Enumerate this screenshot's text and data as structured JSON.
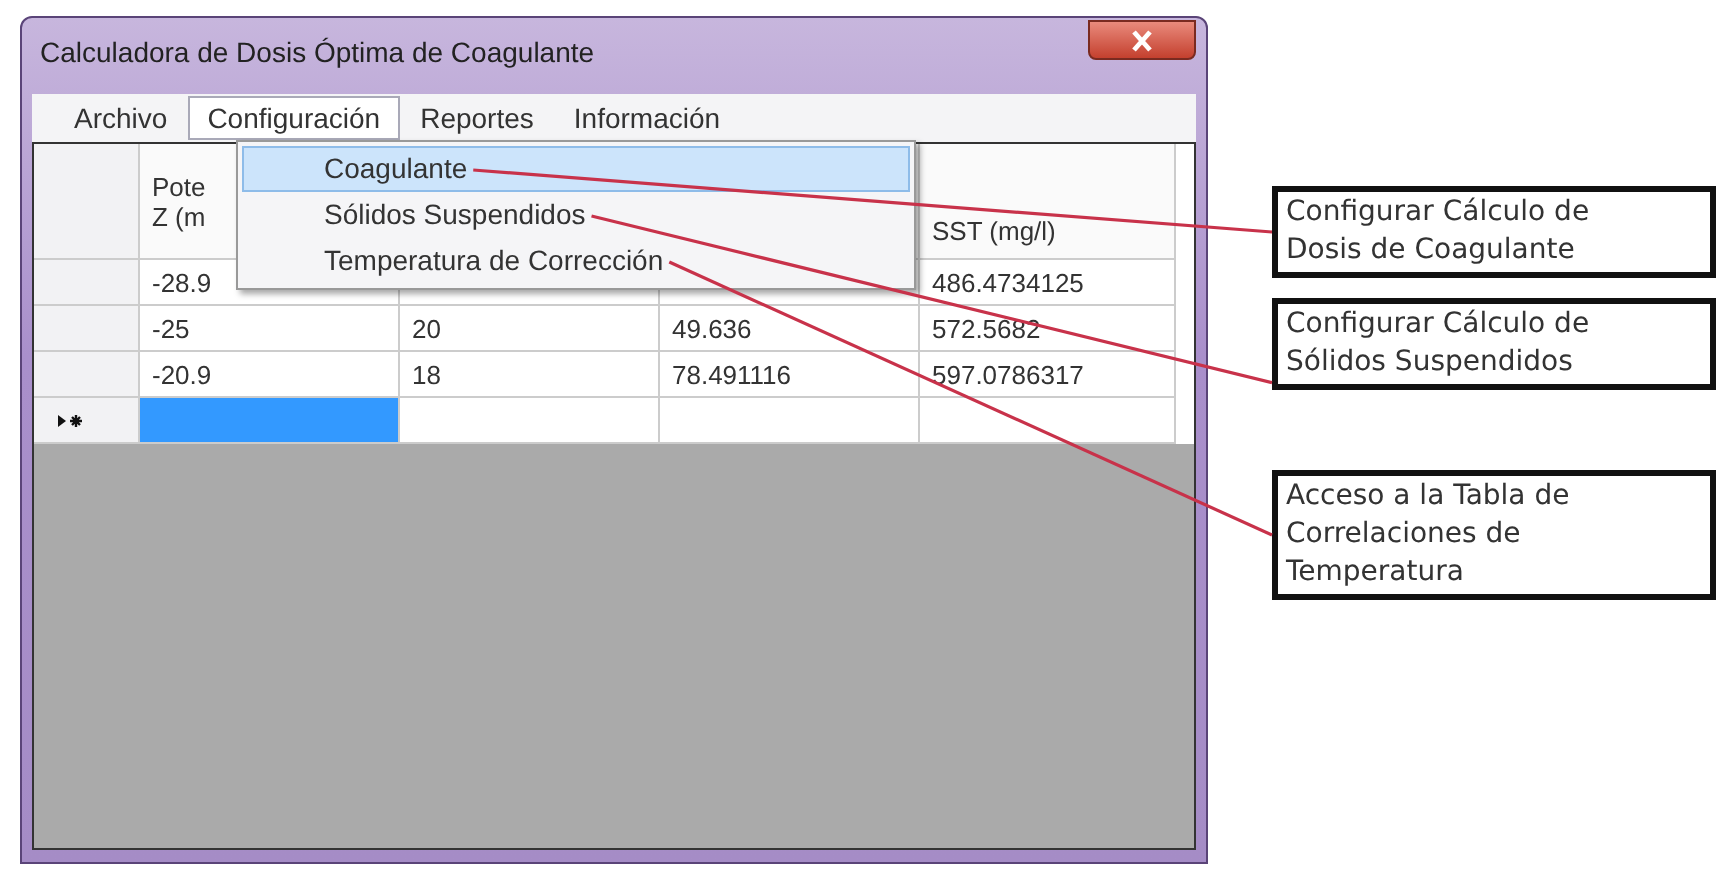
{
  "window": {
    "title": "Calculadora de Dosis Óptima de Coagulante"
  },
  "menu_bar": [
    {
      "label": "Archivo",
      "selected": false
    },
    {
      "label": "Configuración",
      "selected": true
    },
    {
      "label": "Reportes",
      "selected": false
    },
    {
      "label": "Información",
      "selected": false
    }
  ],
  "dropdown": [
    {
      "label": "Coagulante",
      "selected": true
    },
    {
      "label": "Sólidos Suspendidos",
      "selected": false
    },
    {
      "label": "Temperatura de Corrección",
      "selected": false
    }
  ],
  "table": {
    "column_1": [
      "Pote",
      "Z (m"
    ],
    "column_4": [
      "SST (mg/l)"
    ],
    "rows": [
      [
        "-28.9",
        null,
        null,
        "486.4734125"
      ],
      [
        "-25",
        "20",
        "49.636",
        "572.5682"
      ],
      [
        "-20.9",
        "18",
        "78.491116",
        "597.0786317"
      ]
    ],
    "new_row": [
      {
        "selected": true
      },
      {
        "selected": false
      },
      {
        "selected": false
      },
      {
        "selected": false
      }
    ]
  },
  "callouts": [
    {
      "lines": [
        "Configurar Cálculo de",
        "Dosis de Coagulante"
      ]
    },
    {
      "lines": [
        "Configurar Cálculo de",
        "Sólidos Suspendidos"
      ]
    },
    {
      "lines": [
        "Acceso a la Tabla de",
        "Correlaciones de",
        "Temperatura"
      ]
    }
  ]
}
